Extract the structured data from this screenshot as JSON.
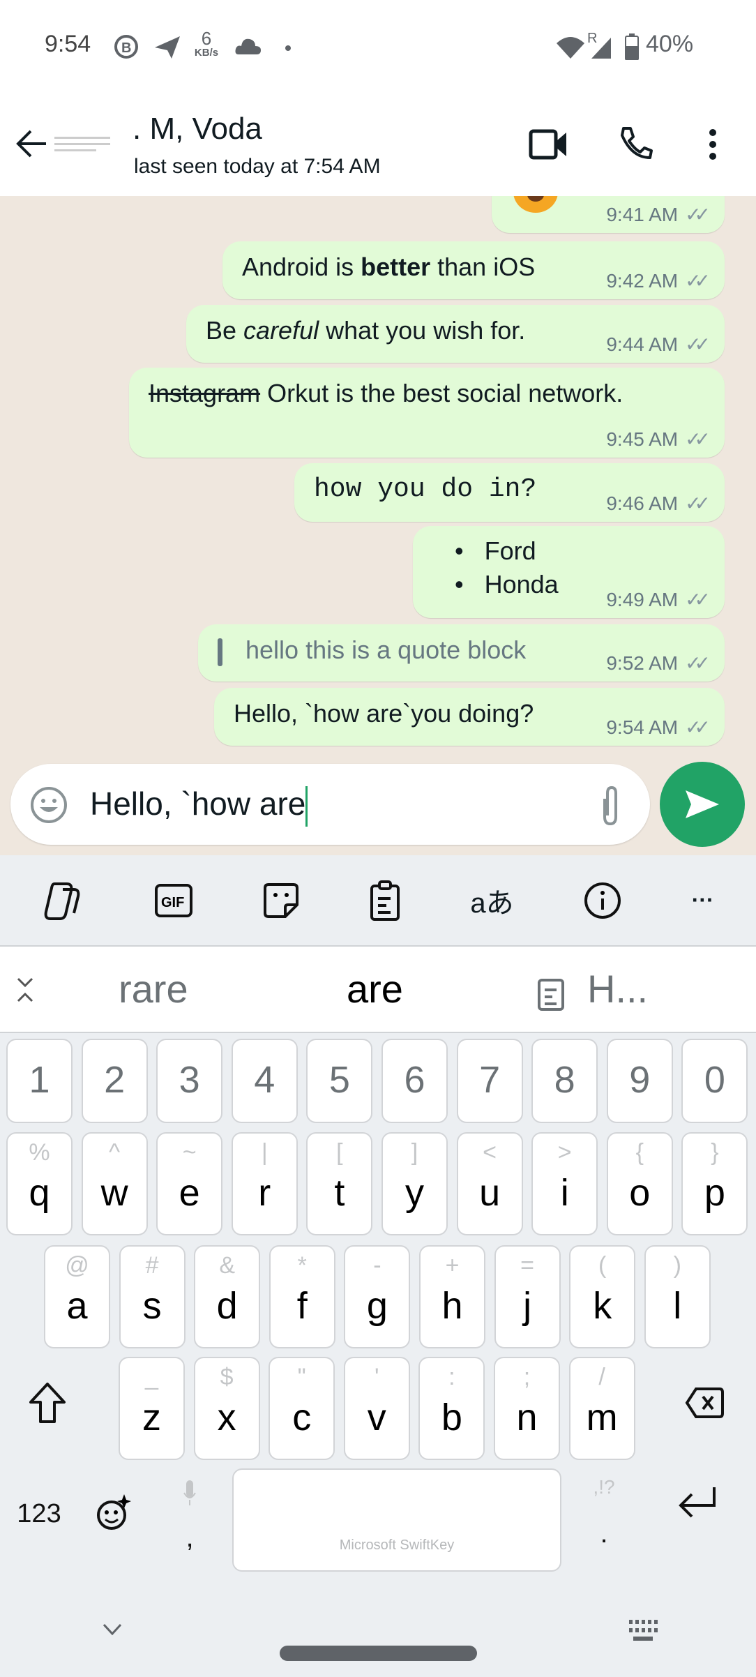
{
  "status_bar": {
    "time": "9:54",
    "speed_value": "6",
    "speed_unit": "KB/s",
    "battery": "40%",
    "signal_label": "R",
    "icons": [
      "whatsapp-business-icon",
      "telegram-icon",
      "cloud-icon",
      "dot-icon",
      "wifi-icon",
      "signal-icon",
      "battery-icon"
    ]
  },
  "header": {
    "title": ". M, Voda",
    "subtitle": "last seen today at 7:54 AM",
    "icons": [
      "back-arrow-icon",
      "video-call-icon",
      "phone-icon",
      "more-vert-icon"
    ]
  },
  "messages": [
    {
      "time": "9:41 AM",
      "type": "emoji"
    },
    {
      "time": "9:42 AM",
      "parts": [
        {
          "t": "Android is ",
          "s": "normal"
        },
        {
          "t": "better",
          "s": "bold"
        },
        {
          "t": " than iOS",
          "s": "normal"
        }
      ]
    },
    {
      "time": "9:44 AM",
      "parts": [
        {
          "t": "Be ",
          "s": "normal"
        },
        {
          "t": "careful",
          "s": "italic"
        },
        {
          "t": " what you wish for.",
          "s": "normal"
        }
      ]
    },
    {
      "time": "9:45 AM",
      "parts": [
        {
          "t": "Instagram",
          "s": "strike"
        },
        {
          "t": " Orkut is the best social network.",
          "s": "normal"
        }
      ]
    },
    {
      "time": "9:46 AM",
      "parts": [
        {
          "t": "how you do in?",
          "s": "mono"
        }
      ]
    },
    {
      "time": "9:49 AM",
      "list": [
        "Ford",
        "Honda"
      ]
    },
    {
      "time": "9:52 AM",
      "quote": "hello this is a quote block"
    },
    {
      "time": "9:54 AM",
      "parts": [
        {
          "t": "Hello, `how are`you doing?",
          "s": "normal"
        }
      ]
    }
  ],
  "ticks": "✓✓",
  "composer": {
    "value": "Hello, `how are",
    "icons": [
      "emoji-icon",
      "attach-icon",
      "send-icon"
    ]
  },
  "keyboard": {
    "toolbar": [
      "copilot-icon",
      "gif-icon",
      "sticker-icon",
      "clipboard-icon",
      "translate-icon",
      "info-icon",
      "more-icon"
    ],
    "suggestions": [
      "rare",
      "are",
      "H..."
    ],
    "numbers": [
      "1",
      "2",
      "3",
      "4",
      "5",
      "6",
      "7",
      "8",
      "9",
      "0"
    ],
    "row1": [
      [
        "q",
        "%"
      ],
      [
        "w",
        "^"
      ],
      [
        "e",
        "~"
      ],
      [
        "r",
        "|"
      ],
      [
        "t",
        "["
      ],
      [
        "y",
        "]"
      ],
      [
        "u",
        "<"
      ],
      [
        "i",
        ">"
      ],
      [
        "o",
        "{"
      ],
      [
        "p",
        "}"
      ]
    ],
    "row2": [
      [
        "a",
        "@"
      ],
      [
        "s",
        "#"
      ],
      [
        "d",
        "&"
      ],
      [
        "f",
        "*"
      ],
      [
        "g",
        "-"
      ],
      [
        "h",
        "+"
      ],
      [
        "j",
        "="
      ],
      [
        "k",
        "("
      ],
      [
        "l",
        ")"
      ]
    ],
    "row3": [
      [
        "z",
        "_"
      ],
      [
        "x",
        "$"
      ],
      [
        "c",
        "\""
      ],
      [
        "v",
        "'"
      ],
      [
        "b",
        ":"
      ],
      [
        "n",
        ";"
      ],
      [
        "m",
        "/"
      ]
    ],
    "mode_label": "123",
    "comma": ",",
    "period": ".",
    "punct_alt": ",!?",
    "space_label": "Microsoft SwiftKey"
  },
  "colors": {
    "accent": "#21a366",
    "bubble": "#e2fbd7",
    "chat_bg": "#efe7de",
    "keyboard_bg": "#eceff2"
  }
}
